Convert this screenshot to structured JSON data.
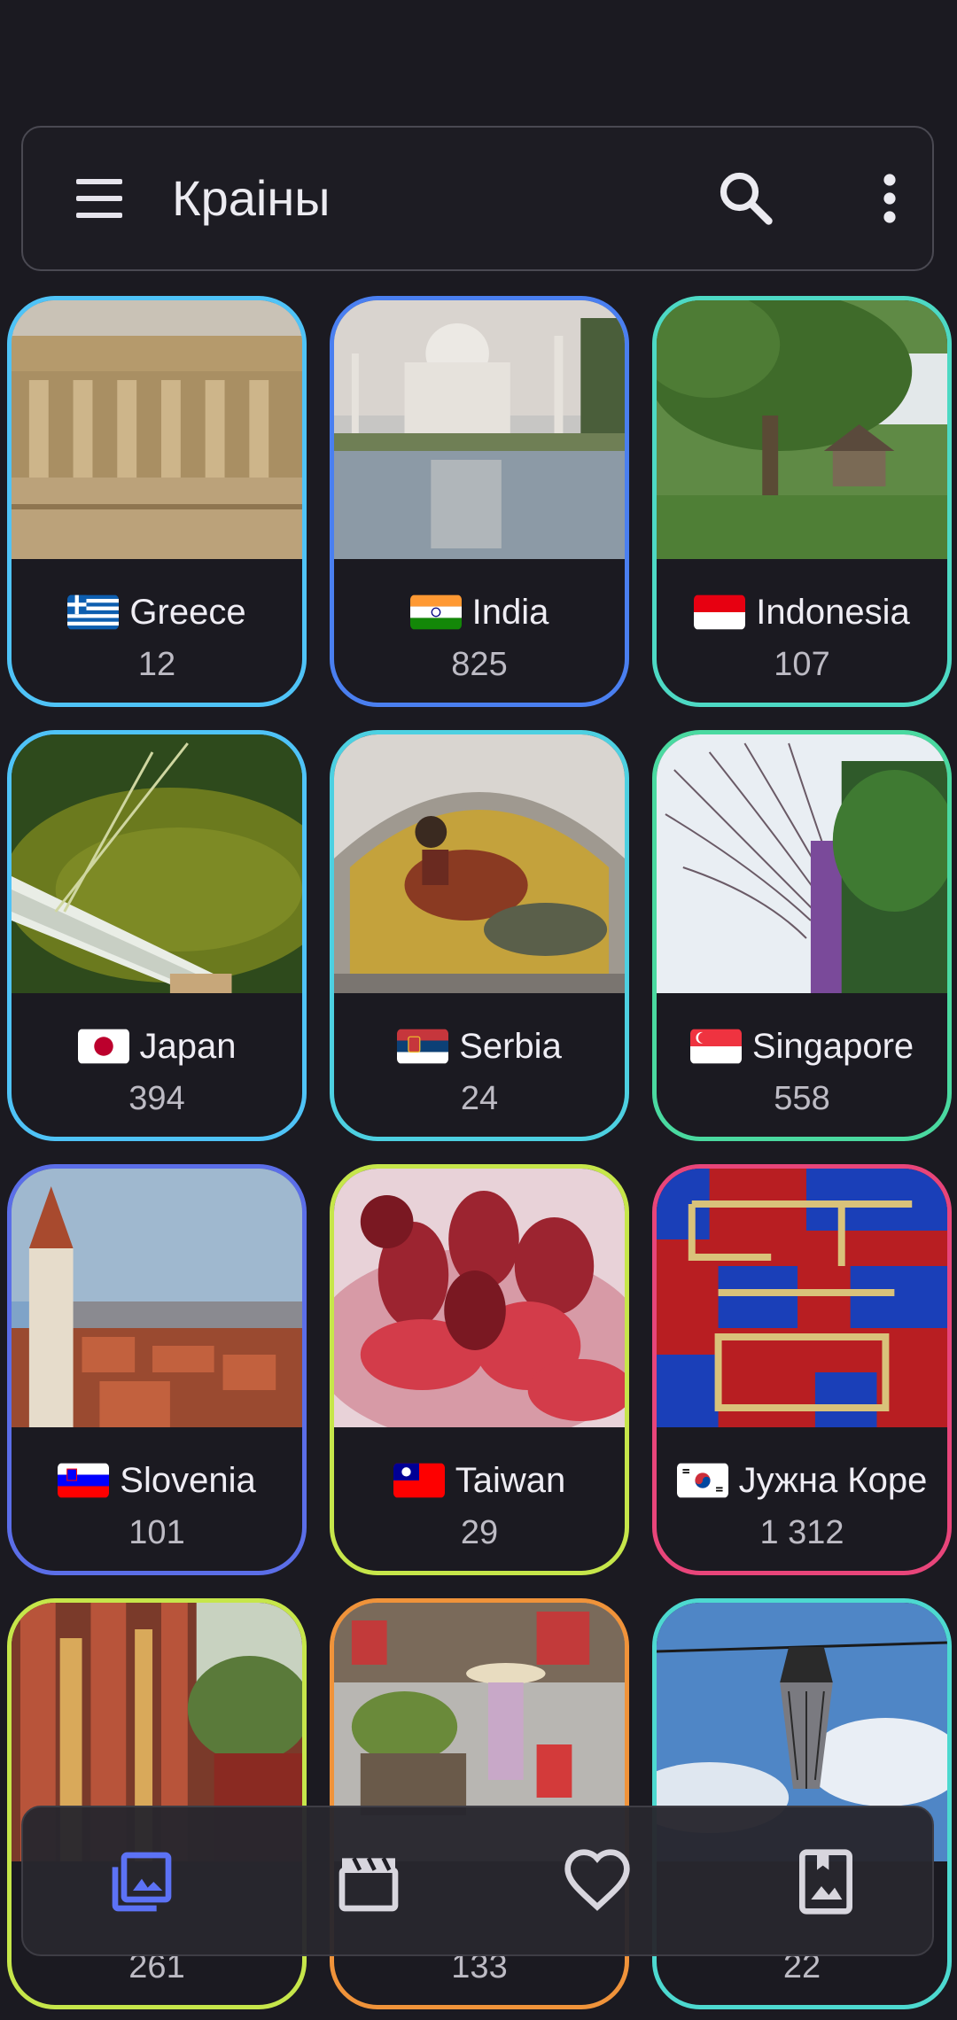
{
  "appbar": {
    "title": "Краіны"
  },
  "icons": {
    "menu": "menu-icon",
    "search": "search-icon",
    "more": "more-vert-icon",
    "photos": "photo-library-icon",
    "videos": "movie-clapper-icon",
    "favorites": "heart-icon",
    "albums": "bookmark-photo-icon"
  },
  "colors": {
    "accent": "#5c72f5",
    "background": "#1b1a21"
  },
  "countries": [
    {
      "name": "Greece",
      "count": "12"
    },
    {
      "name": "India",
      "count": "825"
    },
    {
      "name": "Indonesia",
      "count": "107"
    },
    {
      "name": "Japan",
      "count": "394"
    },
    {
      "name": "Serbia",
      "count": "24"
    },
    {
      "name": "Singapore",
      "count": "558"
    },
    {
      "name": "Slovenia",
      "count": "101"
    },
    {
      "name": "Taiwan",
      "count": "29"
    },
    {
      "name": "Јужна Коре",
      "count": "1 312"
    },
    {
      "name": "",
      "count": "261"
    },
    {
      "name": "",
      "count": "133"
    },
    {
      "name": "",
      "count": "22"
    }
  ],
  "bottom_nav": {
    "selected": "photos"
  }
}
